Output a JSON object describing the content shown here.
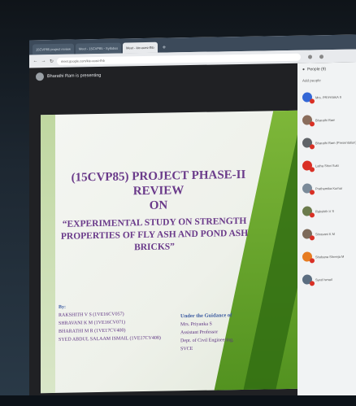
{
  "browser": {
    "tabs": [
      {
        "label": "15CVP85 project review"
      },
      {
        "label": "Meet - 15CVP85 - Syllabus"
      },
      {
        "label": "Meet - kie-ooez-fhb"
      }
    ],
    "add_tab": "+",
    "url": "meet.google.com/kie-ooez-fhb"
  },
  "meet": {
    "presenter": "Bharathi Ram is presenting"
  },
  "slide": {
    "title_line1": "(15CVP85) PROJECT PHASE-II",
    "title_line2": "REVIEW",
    "title_line3": "ON",
    "topic": "“EXPERIMENTAL STUDY ON STRENGTH PROPERTIES OF FLY ASH AND POND ASH BRICKS”",
    "by_label": "By:",
    "students": [
      "RAKSHITH V S (1VE16CV057)",
      "SHRAVANI K M (1VE16CV071)",
      "BHARATHI M R (1VE17CV400)",
      "SYED ABDUL SALAAM ISMAIL (1VE17CV408)"
    ],
    "guide_label": "Under the Guidance of",
    "guide_lines": [
      "Mrs. Priyanka S",
      "Assistant Professor",
      "Dept. of Civil Engineering,",
      "SVCE"
    ]
  },
  "people_panel": {
    "header": "People (9)",
    "add": "Add people",
    "participants": [
      {
        "name": "Mrs. PRIYANKA S",
        "color": "#3367d6"
      },
      {
        "name": "Bharathi Ram",
        "color": "#8a6d5c"
      },
      {
        "name": "Bharathi Ram (Presentation)",
        "color": "#5f6368"
      },
      {
        "name": "Latha Shivi Suki",
        "color": "#d93025"
      },
      {
        "name": "Prathamika Kumar",
        "color": "#7a8a99"
      },
      {
        "name": "Rakshith V S",
        "color": "#6b7b4c"
      },
      {
        "name": "Shravani K M",
        "color": "#7d6a5a"
      },
      {
        "name": "Shobana Shreeja M",
        "color": "#e67c22"
      },
      {
        "name": "Syed Ismail",
        "color": "#5b6d80"
      }
    ]
  }
}
